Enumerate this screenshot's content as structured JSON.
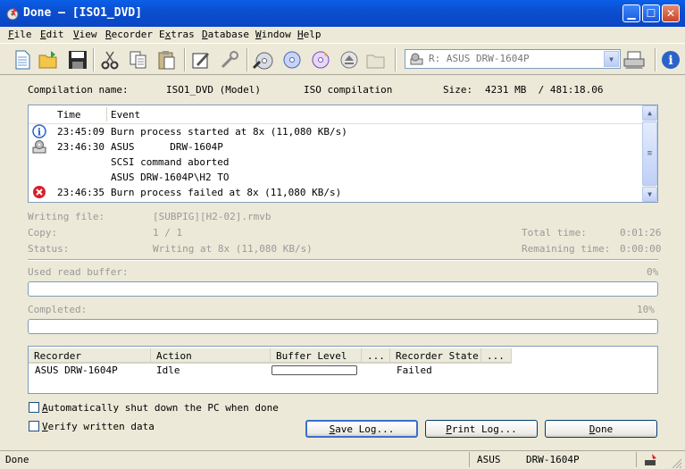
{
  "window": {
    "title": "Done – [ISO1_DVD]",
    "buttons": {
      "minimize": "▁",
      "maximize": "☐",
      "close": "✕"
    }
  },
  "menu": [
    {
      "pre": "",
      "key": "F",
      "rest": "ile"
    },
    {
      "pre": "",
      "key": "E",
      "rest": "dit"
    },
    {
      "pre": "",
      "key": "V",
      "rest": "iew"
    },
    {
      "pre": "",
      "key": "R",
      "rest": "ecorder"
    },
    {
      "pre": "E",
      "key": "x",
      "rest": "tras"
    },
    {
      "pre": "",
      "key": "D",
      "rest": "atabase"
    },
    {
      "pre": "",
      "key": "W",
      "rest": "indow"
    },
    {
      "pre": "",
      "key": "H",
      "rest": "elp"
    }
  ],
  "toolbar": {
    "recorder_select": "R: ASUS      DRW-1604P"
  },
  "compilation": {
    "name_label": "Compilation name:",
    "name_value": "ISO1_DVD (Model)",
    "type": "ISO compilation",
    "size_label": "Size:",
    "size_value": "4231 MB  / 481:18.06"
  },
  "log": {
    "col_time": "Time",
    "col_event": "Event",
    "rows": [
      {
        "icon": "info-icon",
        "time": "23:45:09",
        "event": "Burn process started at 8x (11,080 KB/s)"
      },
      {
        "icon": "drive-icon",
        "time": "23:46:30",
        "event": "ASUS      DRW-1604P"
      },
      {
        "icon": "",
        "time": "",
        "event": "SCSI command aborted"
      },
      {
        "icon": "",
        "time": "",
        "event": "ASUS DRW-1604P\\H2 TO"
      },
      {
        "icon": "error-icon",
        "time": "23:46:35",
        "event": "Burn process failed at 8x (11,080 KB/s)"
      }
    ]
  },
  "status": {
    "writing_file_label": "Writing file:",
    "writing_file_value": "[SUBPIG][H2-02].rmvb",
    "copy_label": "Copy:",
    "copy_value": "1 / 1",
    "status_label": "Status:",
    "status_value": "Writing at 8x (11,080 KB/s)",
    "total_time_label": "Total time:",
    "total_time_value": "0:01:26",
    "remaining_label": "Remaining time:",
    "remaining_value": "0:00:00"
  },
  "buffer": {
    "label": "Used read buffer:",
    "value": "0%",
    "fraction": 0
  },
  "completed": {
    "label": "Completed:",
    "value": "10%",
    "fraction": 0.1
  },
  "recorders": {
    "headers": [
      "Recorder",
      "Action",
      "Buffer Level",
      "...",
      "Recorder State",
      "..."
    ],
    "rows": [
      {
        "recorder": "ASUS DRW-1604P",
        "action": "Idle",
        "buffer_fraction": 0,
        "state": "Failed"
      }
    ]
  },
  "options": {
    "auto_shutdown": {
      "key": "A",
      "rest": "utomatically shut down the PC when done"
    },
    "verify": {
      "key": "V",
      "rest": "erify written data"
    }
  },
  "buttons": {
    "save_log": {
      "key": "S",
      "rest": "ave Log..."
    },
    "print_log": {
      "key": "P",
      "rest": "rint Log..."
    },
    "done": {
      "key": "D",
      "rest": "one"
    }
  },
  "statusbar": {
    "left": "Done",
    "brand": "ASUS",
    "model": "DRW-1604P"
  },
  "colors": {
    "titlebar": "#0A5FE8",
    "error": "#D8202A",
    "info": "#2A63C8",
    "chrome": "#ECE9D8"
  }
}
